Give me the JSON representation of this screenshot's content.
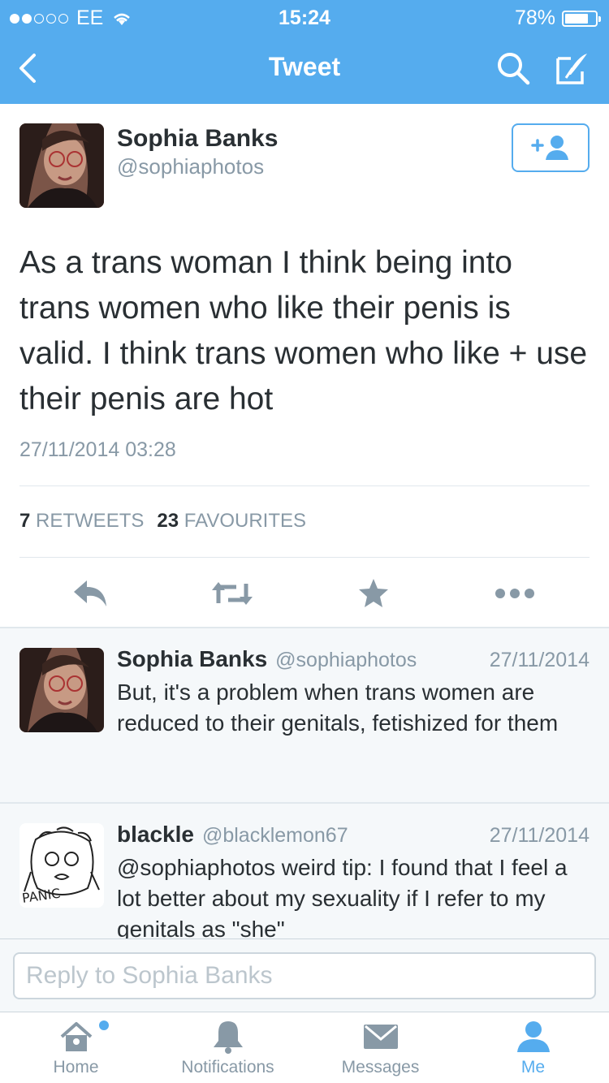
{
  "status_bar": {
    "carrier": "EE",
    "time": "15:24",
    "battery": "78%",
    "battery_level": 0.78
  },
  "nav": {
    "title": "Tweet"
  },
  "tweet": {
    "name": "Sophia Banks",
    "handle": "@sophiaphotos",
    "text": "As a trans woman I think being into trans women who like their penis is valid. I think trans women who like + use their penis are hot",
    "date": "27/11/2014 03:28",
    "retweets_count": "7",
    "retweets_label": "RETWEETS",
    "favourites_count": "23",
    "favourites_label": "FAVOURITES"
  },
  "replies": [
    {
      "name": "Sophia Banks",
      "handle": "@sophiaphotos",
      "date": "27/11/2014",
      "text": "But, it's a problem when trans women are reduced to their genitals, fetishized for them"
    },
    {
      "name": "blackle",
      "handle": "@blacklemon67",
      "date": "27/11/2014",
      "text": "@sophiaphotos weird tip: I found that I feel a lot better about my sexuality if I refer to my genitals as \"she\"",
      "avatar_text": "PANIC"
    }
  ],
  "composer": {
    "placeholder": "Reply to Sophia Banks"
  },
  "tabs": [
    {
      "label": "Home",
      "icon": "home-icon"
    },
    {
      "label": "Notifications",
      "icon": "bell-icon"
    },
    {
      "label": "Messages",
      "icon": "envelope-icon"
    },
    {
      "label": "Me",
      "icon": "person-icon"
    }
  ],
  "colors": {
    "brand": "#55acee",
    "text": "#292f33",
    "muted": "#8899a6",
    "icon_gray": "#8899a6"
  }
}
